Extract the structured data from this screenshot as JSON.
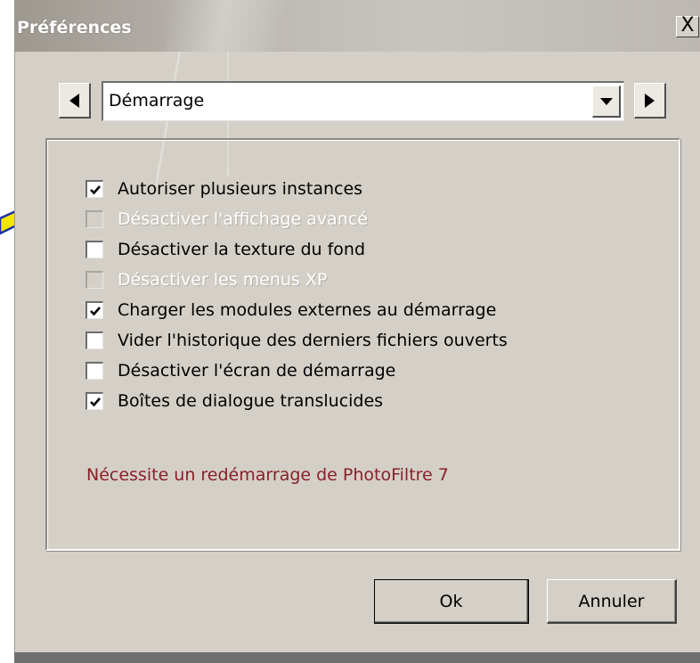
{
  "window": {
    "title": "Préférences",
    "close_symbol": "X"
  },
  "nav": {
    "prev_icon": "triangle-left-icon",
    "next_icon": "triangle-right-icon",
    "category_value": "Démarrage",
    "dropdown_icon": "triangle-down-icon"
  },
  "options": [
    {
      "label": "Autoriser plusieurs instances",
      "checked": true,
      "enabled": true
    },
    {
      "label": "Désactiver l'affichage avancé",
      "checked": false,
      "enabled": false
    },
    {
      "label": "Désactiver la texture du fond",
      "checked": false,
      "enabled": true
    },
    {
      "label": "Désactiver les menus XP",
      "checked": false,
      "enabled": false
    },
    {
      "label": "Charger les modules externes au démarrage",
      "checked": true,
      "enabled": true
    },
    {
      "label": "Vider l'historique des derniers fichiers ouverts",
      "checked": false,
      "enabled": true
    },
    {
      "label": "Désactiver l'écran de démarrage",
      "checked": false,
      "enabled": true
    },
    {
      "label": "Boîtes de dialogue translucides",
      "checked": true,
      "enabled": true
    }
  ],
  "note": "Nécessite un redémarrage de PhotoFiltre 7",
  "buttons": {
    "ok": "Ok",
    "cancel": "Annuler"
  },
  "colors": {
    "dialog_bg": "#d4d0c8",
    "note_text": "#8a2028",
    "arrow_fill": "#f2e600",
    "arrow_outline": "#1c2fa8"
  }
}
